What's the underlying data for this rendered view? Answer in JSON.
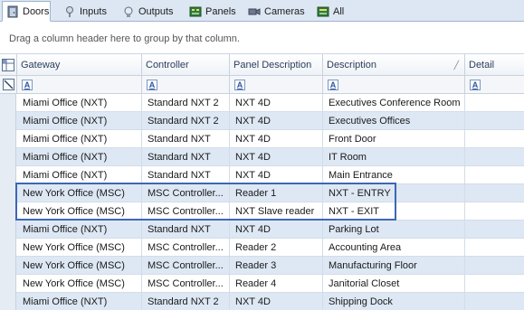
{
  "tabs": [
    {
      "label": "Doors",
      "icon": "door-icon",
      "active": true
    },
    {
      "label": "Inputs",
      "icon": "input-pin-icon",
      "active": false
    },
    {
      "label": "Outputs",
      "icon": "output-bulb-icon",
      "active": false
    },
    {
      "label": "Panels",
      "icon": "panel-board-icon",
      "active": false
    },
    {
      "label": "Cameras",
      "icon": "camera-icon",
      "active": false
    },
    {
      "label": "All",
      "icon": "all-devices-icon",
      "active": false
    }
  ],
  "group_panel": {
    "hint": "Drag a column header here to group by that column."
  },
  "grid": {
    "columns": [
      "Gateway",
      "Controller",
      "Panel Description",
      "Description",
      "Detail"
    ],
    "sorted_column": "Description",
    "filter_button_label": "A",
    "rows": [
      [
        "Miami Office (NXT)",
        "Standard NXT 2",
        "NXT 4D",
        "Executives Conference Room",
        ""
      ],
      [
        "Miami Office (NXT)",
        "Standard NXT 2",
        "NXT 4D",
        "Executives Offices",
        ""
      ],
      [
        "Miami Office (NXT)",
        "Standard NXT",
        "NXT 4D",
        "Front Door",
        ""
      ],
      [
        "Miami Office (NXT)",
        "Standard NXT",
        "NXT 4D",
        "IT Room",
        ""
      ],
      [
        "Miami Office (NXT)",
        "Standard NXT",
        "NXT 4D",
        "Main Entrance",
        ""
      ],
      [
        "New York Office (MSC)",
        "MSC Controller...",
        "Reader 1",
        "NXT - ENTRY",
        ""
      ],
      [
        "New York Office (MSC)",
        "MSC Controller...",
        "NXT Slave reader",
        "NXT - EXIT",
        ""
      ],
      [
        "Miami Office (NXT)",
        "Standard NXT",
        "NXT 4D",
        "Parking Lot",
        ""
      ],
      [
        "New York Office (MSC)",
        "MSC Controller...",
        "Reader 2",
        "Accounting Area",
        ""
      ],
      [
        "New York Office (MSC)",
        "MSC Controller...",
        "Reader 3",
        "Manufacturing Floor",
        ""
      ],
      [
        "New York Office (MSC)",
        "MSC Controller...",
        "Reader 4",
        "Janitorial Closet",
        ""
      ],
      [
        "Miami Office (NXT)",
        "Standard NXT 2",
        "NXT 4D",
        "Shipping Dock",
        ""
      ]
    ]
  },
  "colors": {
    "highlight_border": "#3e67b4",
    "alt_row": "#dde8f4",
    "tab_bar": "#dde7f3"
  }
}
